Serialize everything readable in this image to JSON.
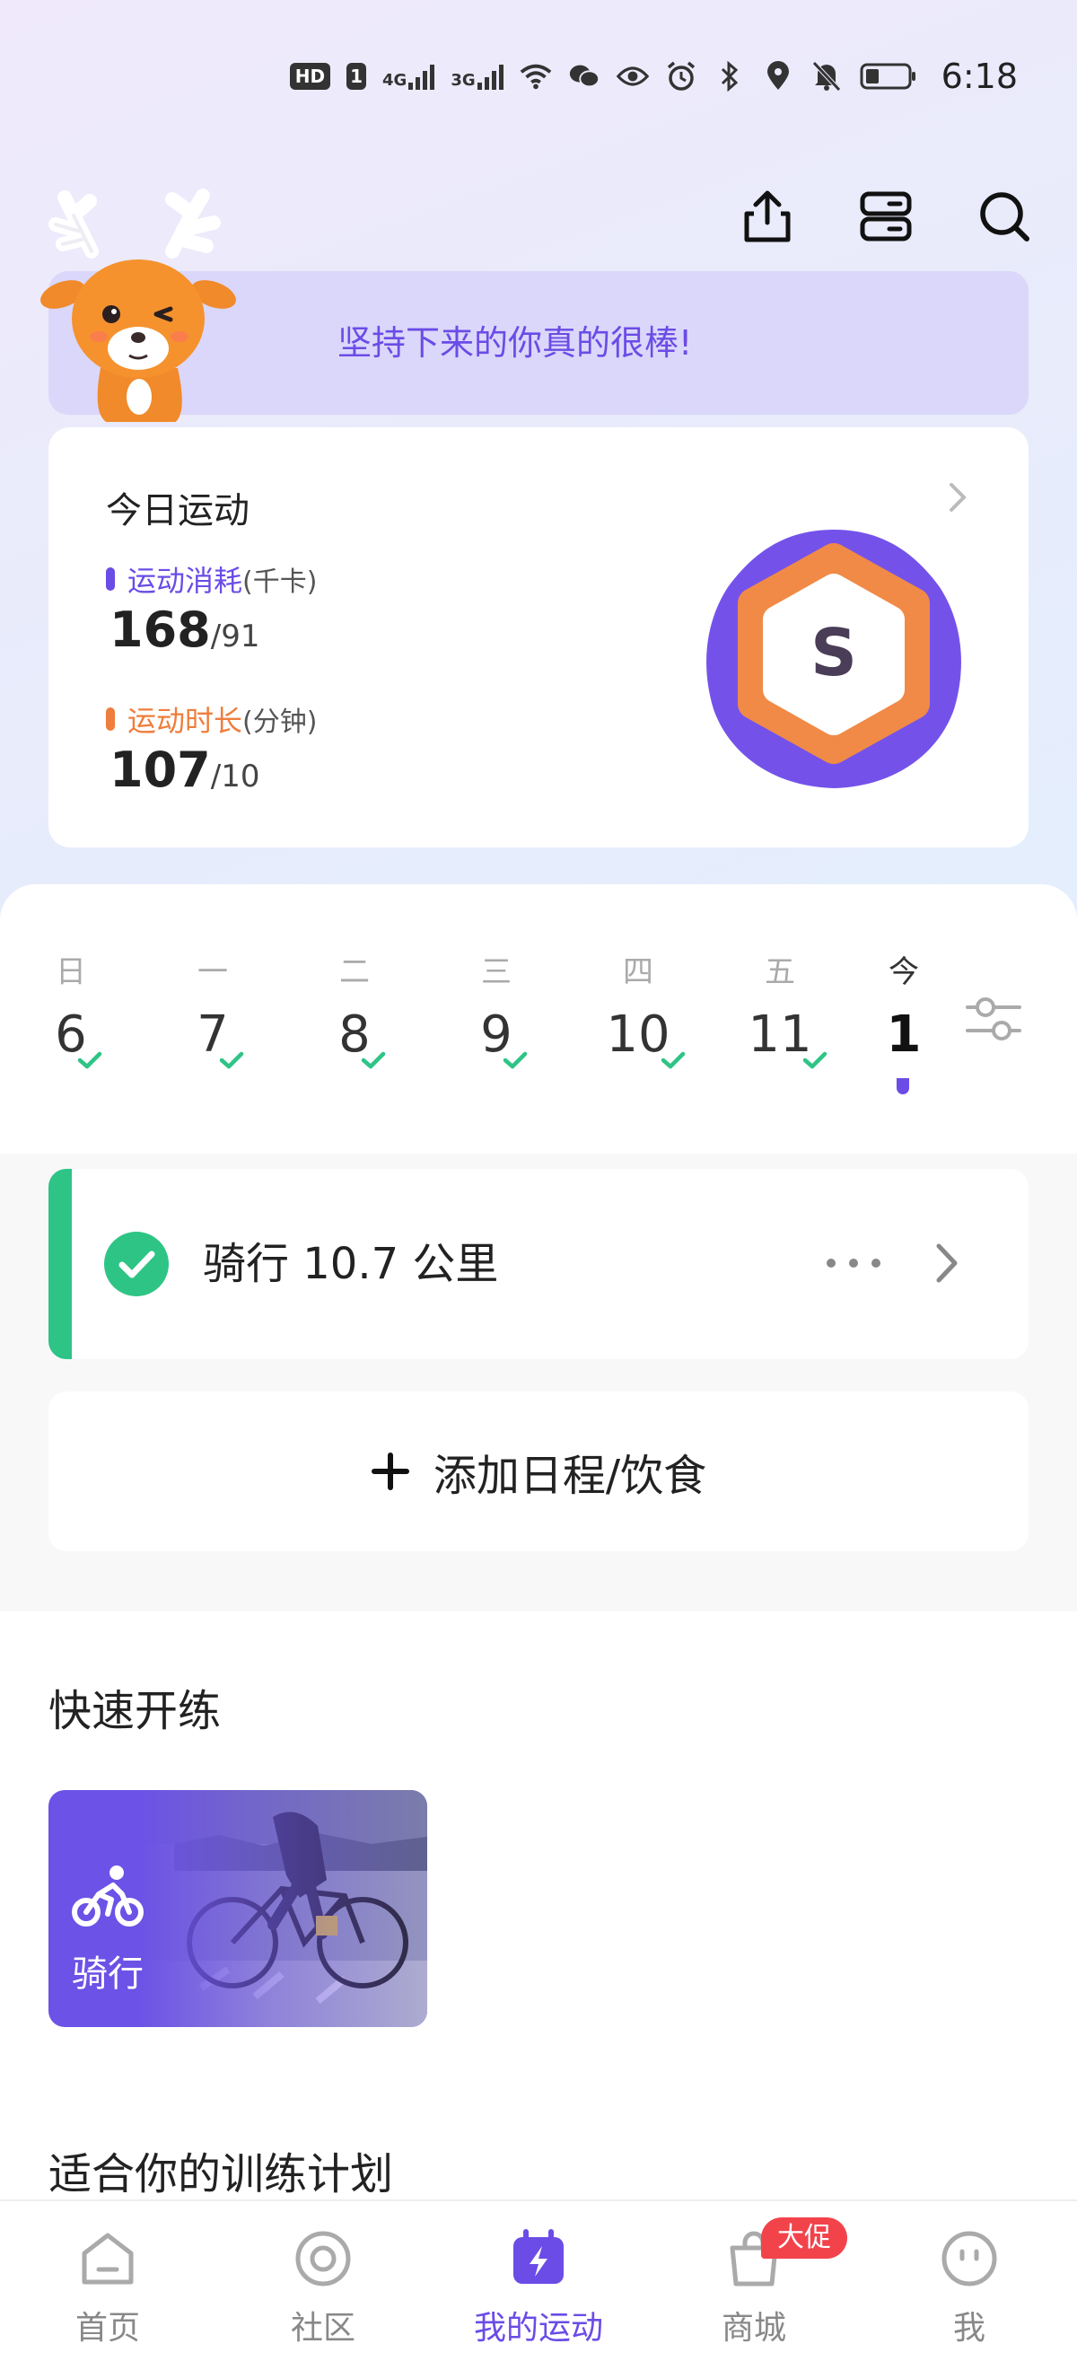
{
  "status_bar": {
    "hd_badge": "HD",
    "sim_slot": "1",
    "net_1": "4G",
    "net_2": "3G",
    "time": "6:18"
  },
  "header": {
    "banner_text": "坚持下来的你真的很棒!"
  },
  "today": {
    "title": "今日运动",
    "calories": {
      "label": "运动消耗",
      "unit": "(千卡)",
      "value": "168",
      "goal": "/91",
      "color": "#6b4ce6"
    },
    "duration": {
      "label": "运动时长",
      "unit": "(分钟)",
      "value": "107",
      "goal": "/10",
      "color": "#ef7d3c"
    },
    "badge_letter": "S"
  },
  "calendar": {
    "days": [
      {
        "label": "日",
        "num": "6",
        "done": true
      },
      {
        "label": "一",
        "num": "7",
        "done": true
      },
      {
        "label": "二",
        "num": "8",
        "done": true
      },
      {
        "label": "三",
        "num": "9",
        "done": true
      },
      {
        "label": "四",
        "num": "10",
        "done": true
      },
      {
        "label": "五",
        "num": "11",
        "done": true
      },
      {
        "label": "今",
        "num": "1",
        "done": false,
        "today": true
      }
    ]
  },
  "activity": {
    "text": "骑行 10.7 公里",
    "status_color": "#2ec486"
  },
  "add_schedule": {
    "label": "添加日程/饮食"
  },
  "quick_start": {
    "title": "快速开练",
    "item_label": "骑行"
  },
  "plan": {
    "title": "适合你的训练计划"
  },
  "tabbar": {
    "items": [
      {
        "label": "首页",
        "icon": "home-icon"
      },
      {
        "label": "社区",
        "icon": "community-icon"
      },
      {
        "label": "我的运动",
        "icon": "my-sports-icon",
        "active": true
      },
      {
        "label": "商城",
        "icon": "shop-bag-icon"
      },
      {
        "label": "我",
        "icon": "profile-face-icon"
      }
    ],
    "promo_badge": "大促",
    "accent": "#6b4ce6"
  }
}
